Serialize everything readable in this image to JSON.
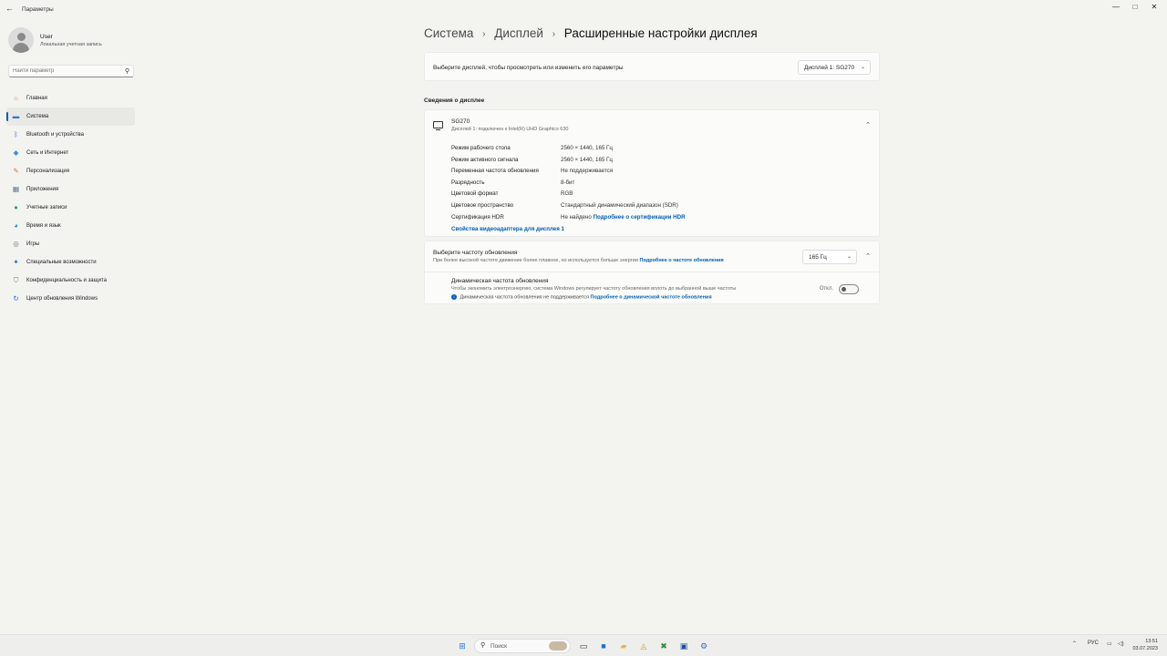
{
  "window": {
    "app_title": "Параметры",
    "back_icon": "arrow-left-icon",
    "minimize": "—",
    "maximize": "□",
    "close": "✕"
  },
  "profile": {
    "name": "User",
    "account_type": "Локальная учетная запись"
  },
  "search": {
    "placeholder": "Найти параметр"
  },
  "sidebar": {
    "items": [
      {
        "label": "Главная",
        "icon": "home-icon",
        "glyph": "⌂",
        "color": "#e07a2e",
        "active": false
      },
      {
        "label": "Система",
        "icon": "system-icon",
        "glyph": "▬",
        "color": "#2b7ad0",
        "active": true
      },
      {
        "label": "Bluetooth и устройства",
        "icon": "bluetooth-icon",
        "glyph": "ᛒ",
        "color": "#1e6fc9",
        "active": false
      },
      {
        "label": "Сеть и Интернет",
        "icon": "wifi-icon",
        "glyph": "◆",
        "color": "#3a8fd8",
        "active": false
      },
      {
        "label": "Персонализация",
        "icon": "brush-icon",
        "glyph": "✎",
        "color": "#d67a2c",
        "active": false
      },
      {
        "label": "Приложения",
        "icon": "apps-icon",
        "glyph": "▦",
        "color": "#5b6f8a",
        "active": false
      },
      {
        "label": "Учетные записи",
        "icon": "person-icon",
        "glyph": "●",
        "color": "#22a37c",
        "active": false
      },
      {
        "label": "Время и язык",
        "icon": "globe-icon",
        "glyph": "◕",
        "color": "#2b8ad3",
        "active": false
      },
      {
        "label": "Игры",
        "icon": "gamepad-icon",
        "glyph": "◎",
        "color": "#6a6a6a",
        "active": false
      },
      {
        "label": "Специальные возможности",
        "icon": "accessibility-icon",
        "glyph": "✦",
        "color": "#1f6fc4",
        "active": false
      },
      {
        "label": "Конфиденциальность и защита",
        "icon": "shield-icon",
        "glyph": "⛉",
        "color": "#6a6a6a",
        "active": false
      },
      {
        "label": "Центр обновления Windows",
        "icon": "update-icon",
        "glyph": "↻",
        "color": "#1f6fc4",
        "active": false
      }
    ]
  },
  "breadcrumb": {
    "item1": "Система",
    "item2": "Дисплей",
    "current": "Расширенные настройки дисплея",
    "separator": "›"
  },
  "display_select": {
    "label": "Выберите дисплей, чтобы просмотреть или изменить его параметры",
    "value": "Дисплей 1: SG270"
  },
  "display_info": {
    "section_title": "Сведения о дисплее",
    "monitor_name": "SG270",
    "monitor_sub": "Дисплей 1: подключен к Intel(R) UHD Graphics 630",
    "rows": [
      {
        "key": "Режим рабочего стола",
        "value": "2560 × 1440, 165 Гц"
      },
      {
        "key": "Режим активного сигнала",
        "value": "2560 × 1440, 165 Гц"
      },
      {
        "key": "Переменная частота обновления",
        "value": "Не поддерживается"
      },
      {
        "key": "Разрядность",
        "value": "8-бит"
      },
      {
        "key": "Цветовой формат",
        "value": "RGB"
      },
      {
        "key": "Цветовое пространство",
        "value": "Стандартный динамический диапазон (SDR)"
      }
    ],
    "hdr_key": "Сертификация HDR",
    "hdr_value": "Не найдено",
    "hdr_link": "Подробнее о сертификации HDR",
    "adapter_link": "Свойства видеоадаптера для дисплея 1"
  },
  "refresh": {
    "title": "Выберите частоту обновления",
    "subtitle_text": "При более высокой частоте движение более плавное, но используется больше энергии",
    "subtitle_link": "Подробнее о частоте обновления",
    "value": "165 Гц",
    "dynamic_title": "Динамическая частота обновления",
    "dynamic_sub": "Чтобы экономить электроэнергию, система Windows регулирует частоту обновления вплоть до выбранной выше частоты",
    "dynamic_info_text": "Динамическая частота обновления не поддерживается",
    "dynamic_info_link": "Подробнее о динамической частоте обновления",
    "toggle_label": "Откл.",
    "toggle_on": false
  },
  "taskbar": {
    "search_placeholder": "Поиск",
    "lang": "РУС",
    "time": "13:51",
    "date": "03.07.2023"
  }
}
